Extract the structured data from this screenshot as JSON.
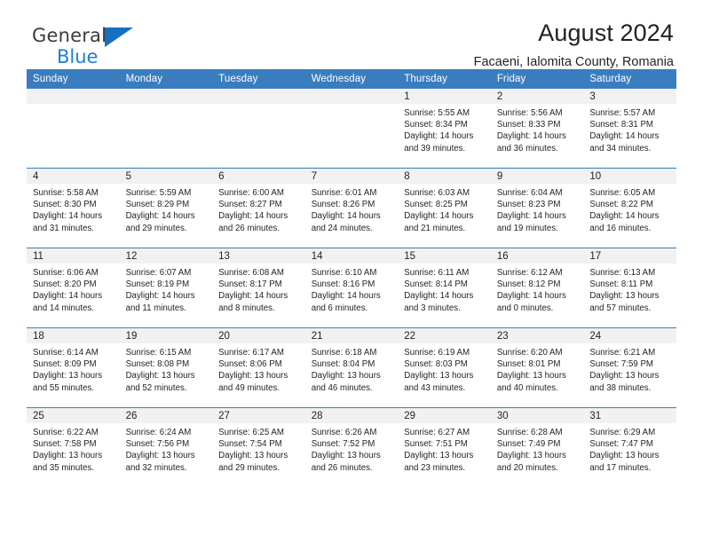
{
  "brand": {
    "name_line1": "General",
    "name_line2": "Blue",
    "triangle_color": "#176fc1",
    "blue_text_color": "#1f7fd0"
  },
  "header": {
    "title": "August 2024",
    "subtitle": "Facaeni, Ialomita County, Romania"
  },
  "theme": {
    "header_bar_color": "#3a7dbf",
    "daynum_band_color": "#f1f1f1",
    "text_color": "#231f20"
  },
  "weekday_headers": [
    "Sunday",
    "Monday",
    "Tuesday",
    "Wednesday",
    "Thursday",
    "Friday",
    "Saturday"
  ],
  "weeks": [
    {
      "days": [
        {
          "num": "",
          "sunrise": "",
          "sunset": "",
          "daylight_line1": "",
          "daylight_line2": ""
        },
        {
          "num": "",
          "sunrise": "",
          "sunset": "",
          "daylight_line1": "",
          "daylight_line2": ""
        },
        {
          "num": "",
          "sunrise": "",
          "sunset": "",
          "daylight_line1": "",
          "daylight_line2": ""
        },
        {
          "num": "",
          "sunrise": "",
          "sunset": "",
          "daylight_line1": "",
          "daylight_line2": ""
        },
        {
          "num": "1",
          "sunrise": "Sunrise: 5:55 AM",
          "sunset": "Sunset: 8:34 PM",
          "daylight_line1": "Daylight: 14 hours",
          "daylight_line2": "and 39 minutes."
        },
        {
          "num": "2",
          "sunrise": "Sunrise: 5:56 AM",
          "sunset": "Sunset: 8:33 PM",
          "daylight_line1": "Daylight: 14 hours",
          "daylight_line2": "and 36 minutes."
        },
        {
          "num": "3",
          "sunrise": "Sunrise: 5:57 AM",
          "sunset": "Sunset: 8:31 PM",
          "daylight_line1": "Daylight: 14 hours",
          "daylight_line2": "and 34 minutes."
        }
      ]
    },
    {
      "days": [
        {
          "num": "4",
          "sunrise": "Sunrise: 5:58 AM",
          "sunset": "Sunset: 8:30 PM",
          "daylight_line1": "Daylight: 14 hours",
          "daylight_line2": "and 31 minutes."
        },
        {
          "num": "5",
          "sunrise": "Sunrise: 5:59 AM",
          "sunset": "Sunset: 8:29 PM",
          "daylight_line1": "Daylight: 14 hours",
          "daylight_line2": "and 29 minutes."
        },
        {
          "num": "6",
          "sunrise": "Sunrise: 6:00 AM",
          "sunset": "Sunset: 8:27 PM",
          "daylight_line1": "Daylight: 14 hours",
          "daylight_line2": "and 26 minutes."
        },
        {
          "num": "7",
          "sunrise": "Sunrise: 6:01 AM",
          "sunset": "Sunset: 8:26 PM",
          "daylight_line1": "Daylight: 14 hours",
          "daylight_line2": "and 24 minutes."
        },
        {
          "num": "8",
          "sunrise": "Sunrise: 6:03 AM",
          "sunset": "Sunset: 8:25 PM",
          "daylight_line1": "Daylight: 14 hours",
          "daylight_line2": "and 21 minutes."
        },
        {
          "num": "9",
          "sunrise": "Sunrise: 6:04 AM",
          "sunset": "Sunset: 8:23 PM",
          "daylight_line1": "Daylight: 14 hours",
          "daylight_line2": "and 19 minutes."
        },
        {
          "num": "10",
          "sunrise": "Sunrise: 6:05 AM",
          "sunset": "Sunset: 8:22 PM",
          "daylight_line1": "Daylight: 14 hours",
          "daylight_line2": "and 16 minutes."
        }
      ]
    },
    {
      "days": [
        {
          "num": "11",
          "sunrise": "Sunrise: 6:06 AM",
          "sunset": "Sunset: 8:20 PM",
          "daylight_line1": "Daylight: 14 hours",
          "daylight_line2": "and 14 minutes."
        },
        {
          "num": "12",
          "sunrise": "Sunrise: 6:07 AM",
          "sunset": "Sunset: 8:19 PM",
          "daylight_line1": "Daylight: 14 hours",
          "daylight_line2": "and 11 minutes."
        },
        {
          "num": "13",
          "sunrise": "Sunrise: 6:08 AM",
          "sunset": "Sunset: 8:17 PM",
          "daylight_line1": "Daylight: 14 hours",
          "daylight_line2": "and 8 minutes."
        },
        {
          "num": "14",
          "sunrise": "Sunrise: 6:10 AM",
          "sunset": "Sunset: 8:16 PM",
          "daylight_line1": "Daylight: 14 hours",
          "daylight_line2": "and 6 minutes."
        },
        {
          "num": "15",
          "sunrise": "Sunrise: 6:11 AM",
          "sunset": "Sunset: 8:14 PM",
          "daylight_line1": "Daylight: 14 hours",
          "daylight_line2": "and 3 minutes."
        },
        {
          "num": "16",
          "sunrise": "Sunrise: 6:12 AM",
          "sunset": "Sunset: 8:12 PM",
          "daylight_line1": "Daylight: 14 hours",
          "daylight_line2": "and 0 minutes."
        },
        {
          "num": "17",
          "sunrise": "Sunrise: 6:13 AM",
          "sunset": "Sunset: 8:11 PM",
          "daylight_line1": "Daylight: 13 hours",
          "daylight_line2": "and 57 minutes."
        }
      ]
    },
    {
      "days": [
        {
          "num": "18",
          "sunrise": "Sunrise: 6:14 AM",
          "sunset": "Sunset: 8:09 PM",
          "daylight_line1": "Daylight: 13 hours",
          "daylight_line2": "and 55 minutes."
        },
        {
          "num": "19",
          "sunrise": "Sunrise: 6:15 AM",
          "sunset": "Sunset: 8:08 PM",
          "daylight_line1": "Daylight: 13 hours",
          "daylight_line2": "and 52 minutes."
        },
        {
          "num": "20",
          "sunrise": "Sunrise: 6:17 AM",
          "sunset": "Sunset: 8:06 PM",
          "daylight_line1": "Daylight: 13 hours",
          "daylight_line2": "and 49 minutes."
        },
        {
          "num": "21",
          "sunrise": "Sunrise: 6:18 AM",
          "sunset": "Sunset: 8:04 PM",
          "daylight_line1": "Daylight: 13 hours",
          "daylight_line2": "and 46 minutes."
        },
        {
          "num": "22",
          "sunrise": "Sunrise: 6:19 AM",
          "sunset": "Sunset: 8:03 PM",
          "daylight_line1": "Daylight: 13 hours",
          "daylight_line2": "and 43 minutes."
        },
        {
          "num": "23",
          "sunrise": "Sunrise: 6:20 AM",
          "sunset": "Sunset: 8:01 PM",
          "daylight_line1": "Daylight: 13 hours",
          "daylight_line2": "and 40 minutes."
        },
        {
          "num": "24",
          "sunrise": "Sunrise: 6:21 AM",
          "sunset": "Sunset: 7:59 PM",
          "daylight_line1": "Daylight: 13 hours",
          "daylight_line2": "and 38 minutes."
        }
      ]
    },
    {
      "days": [
        {
          "num": "25",
          "sunrise": "Sunrise: 6:22 AM",
          "sunset": "Sunset: 7:58 PM",
          "daylight_line1": "Daylight: 13 hours",
          "daylight_line2": "and 35 minutes."
        },
        {
          "num": "26",
          "sunrise": "Sunrise: 6:24 AM",
          "sunset": "Sunset: 7:56 PM",
          "daylight_line1": "Daylight: 13 hours",
          "daylight_line2": "and 32 minutes."
        },
        {
          "num": "27",
          "sunrise": "Sunrise: 6:25 AM",
          "sunset": "Sunset: 7:54 PM",
          "daylight_line1": "Daylight: 13 hours",
          "daylight_line2": "and 29 minutes."
        },
        {
          "num": "28",
          "sunrise": "Sunrise: 6:26 AM",
          "sunset": "Sunset: 7:52 PM",
          "daylight_line1": "Daylight: 13 hours",
          "daylight_line2": "and 26 minutes."
        },
        {
          "num": "29",
          "sunrise": "Sunrise: 6:27 AM",
          "sunset": "Sunset: 7:51 PM",
          "daylight_line1": "Daylight: 13 hours",
          "daylight_line2": "and 23 minutes."
        },
        {
          "num": "30",
          "sunrise": "Sunrise: 6:28 AM",
          "sunset": "Sunset: 7:49 PM",
          "daylight_line1": "Daylight: 13 hours",
          "daylight_line2": "and 20 minutes."
        },
        {
          "num": "31",
          "sunrise": "Sunrise: 6:29 AM",
          "sunset": "Sunset: 7:47 PM",
          "daylight_line1": "Daylight: 13 hours",
          "daylight_line2": "and 17 minutes."
        }
      ]
    }
  ]
}
